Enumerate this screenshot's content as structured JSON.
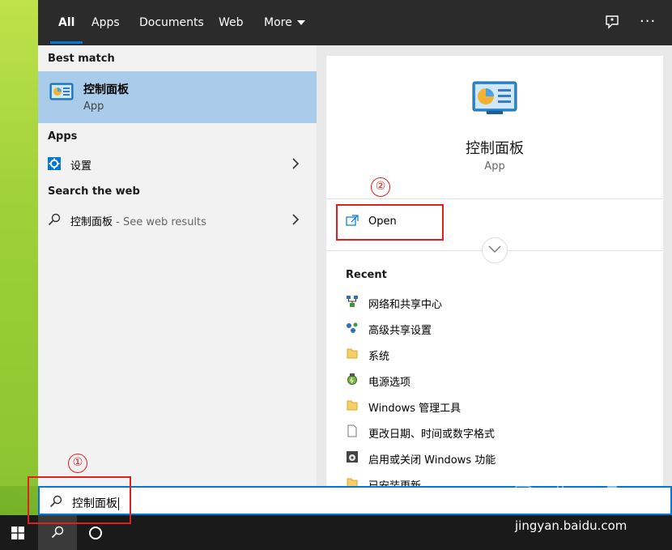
{
  "tabs": [
    {
      "label": "All"
    },
    {
      "label": "Apps"
    },
    {
      "label": "Documents"
    },
    {
      "label": "Web"
    },
    {
      "label": "More"
    }
  ],
  "left": {
    "best_match_title": "Best match",
    "best_match": {
      "name": "控制面板",
      "type": "App"
    },
    "apps_title": "Apps",
    "apps_item": "设置",
    "web_title": "Search the web",
    "web_item": {
      "query": "控制面板",
      "suffix": " - See web results"
    }
  },
  "right": {
    "app_name": "控制面板",
    "app_type": "App",
    "open_label": "Open",
    "recent_title": "Recent",
    "recent": [
      {
        "label": "网络和共享中心",
        "icon": "network-icon"
      },
      {
        "label": "高级共享设置",
        "icon": "sharing-icon"
      },
      {
        "label": "系统",
        "icon": "folder-icon"
      },
      {
        "label": "电源选项",
        "icon": "power-icon"
      },
      {
        "label": "Windows 管理工具",
        "icon": "folder-icon"
      },
      {
        "label": "更改日期、时间或数字格式",
        "icon": "file-icon"
      },
      {
        "label": "启用或关闭 Windows 功能",
        "icon": "features-icon"
      },
      {
        "label": "已安装更新",
        "icon": "folder-icon"
      }
    ]
  },
  "search": {
    "value": "控制面板"
  },
  "annotations": {
    "step1": "①",
    "step2": "②"
  },
  "watermark": {
    "url": "jingyan.baidu.com"
  },
  "colors": {
    "accent": "#0078d7",
    "selection": "#a9ccea",
    "annotation": "#e02020"
  }
}
